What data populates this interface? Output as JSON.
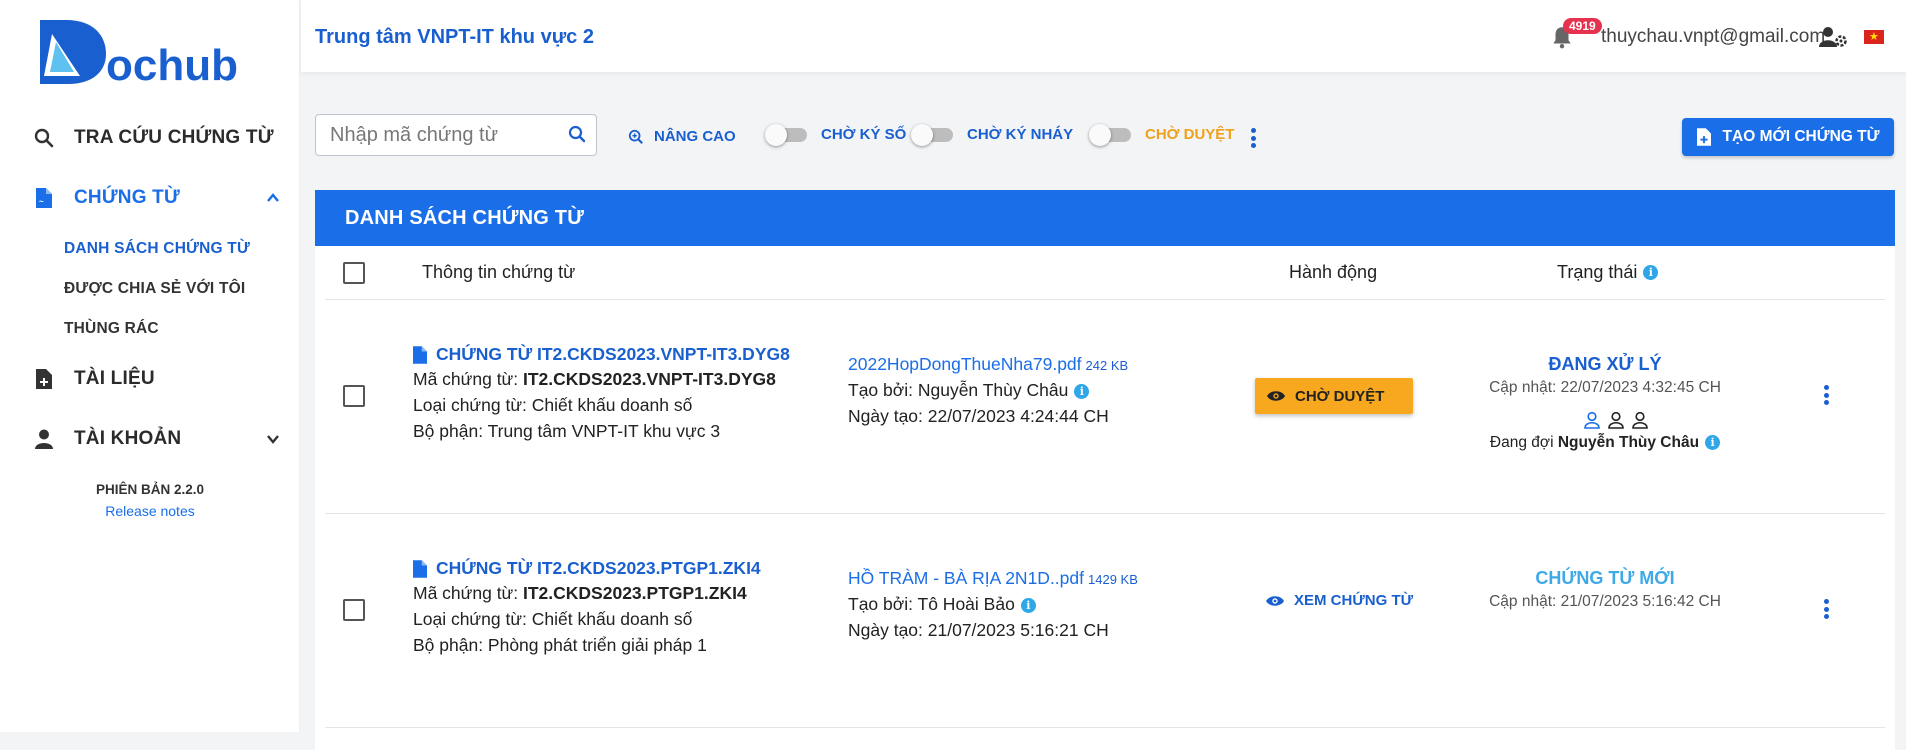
{
  "brand": {
    "logo_text": "Dochub"
  },
  "sidebar": {
    "lookup": "TRA CỨU CHỨNG TỪ",
    "documents": "CHỨNG TỪ",
    "sub": [
      "DANH SÁCH CHỨNG TỪ",
      "ĐƯỢC CHIA SẺ VỚI TÔI",
      "THÙNG RÁC"
    ],
    "files": "TÀI LIỆU",
    "account": "TÀI KHOẢN",
    "version": "PHIÊN BẢN 2.2.0",
    "release_notes": "Release notes"
  },
  "header": {
    "org": "Trung tâm VNPT-IT khu vực 2",
    "notification_count": "4919",
    "email": "thuychau.vnpt@gmail.com"
  },
  "toolbar": {
    "search_placeholder": "Nhập mã chứng từ",
    "advanced": "NÂNG CAO",
    "toggle_digital_sign": "CHỜ KÝ SỐ",
    "toggle_initial_sign": "CHỜ KÝ NHÁY",
    "toggle_approve": "CHỜ DUYỆT",
    "create_new": "TẠO MỚI CHỨNG TỪ"
  },
  "table": {
    "title": "DANH SÁCH CHỨNG TỪ",
    "col_info": "Thông tin chứng từ",
    "col_action": "Hành động",
    "col_status": "Trạng thái",
    "rows": [
      {
        "title": "CHỨNG TỪ IT2.CKDS2023.VNPT-IT3.DYG8",
        "code_label": "Mã chứng từ: ",
        "code": "IT2.CKDS2023.VNPT-IT3.DYG8",
        "type": "Loại chứng từ: Chiết khấu doanh số",
        "dept": "Bộ phận: Trung tâm VNPT-IT khu vực 3",
        "file": "2022HopDongThueNha79.pdf",
        "size": "242 KB",
        "created_by": "Tạo bởi: Nguyễn Thùy Châu",
        "created_at": "Ngày tạo: 22/07/2023 4:24:44 CH",
        "action": "CHỜ DUYỆT",
        "status": "ĐANG XỬ LÝ",
        "updated": "Cập nhật: 22/07/2023 4:32:45 CH",
        "waiting_label": "Đang đợi ",
        "waiting_person": "Nguyễn Thùy Châu"
      },
      {
        "title": "CHỨNG TỪ IT2.CKDS2023.PTGP1.ZKI4",
        "code_label": "Mã chứng từ: ",
        "code": "IT2.CKDS2023.PTGP1.ZKI4",
        "type": "Loại chứng từ: Chiết khấu doanh số",
        "dept": "Bộ phận: Phòng phát triển giải pháp 1",
        "file": "HỒ TRÀM - BÀ RỊA 2N1D..pdf",
        "size": "1429 KB",
        "created_by": "Tạo bởi: Tô Hoài Bảo",
        "created_at": "Ngày tạo: 21/07/2023 5:16:21 CH",
        "action": "XEM CHỨNG TỪ",
        "status": "CHỨNG TỪ MỚI",
        "updated": "Cập nhật: 21/07/2023 5:16:42 CH"
      }
    ]
  },
  "colors": {
    "primary": "#1a6ee8",
    "warning": "#f7a81e",
    "new_status": "#3fa9e6",
    "badge": "#e5334f"
  }
}
